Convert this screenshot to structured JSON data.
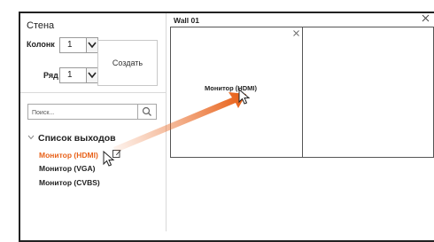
{
  "left_panel": {
    "title": "Стена",
    "columns_label": "Колонк",
    "columns_value": "1",
    "rows_label": "Ряд",
    "rows_value": "1",
    "create_button": "Создать",
    "search_placeholder": "Поиск...",
    "output_list_title": "Список выходов",
    "outputs": [
      {
        "label": "Монитор (HDMI)",
        "selected": true
      },
      {
        "label": "Монитор (VGA)",
        "selected": false
      },
      {
        "label": "Монитор (CVBS)",
        "selected": false
      }
    ]
  },
  "wall": {
    "title": "Wall 01",
    "cells": [
      {
        "label": "Монитор (HDMI)"
      },
      {
        "label": ""
      }
    ]
  },
  "colors": {
    "accent": "#e8621a",
    "border": "#555555"
  },
  "icons": [
    "chevron-down-icon",
    "search-icon",
    "edit-icon",
    "close-icon",
    "cursor-icon",
    "drag-arrow-icon"
  ]
}
